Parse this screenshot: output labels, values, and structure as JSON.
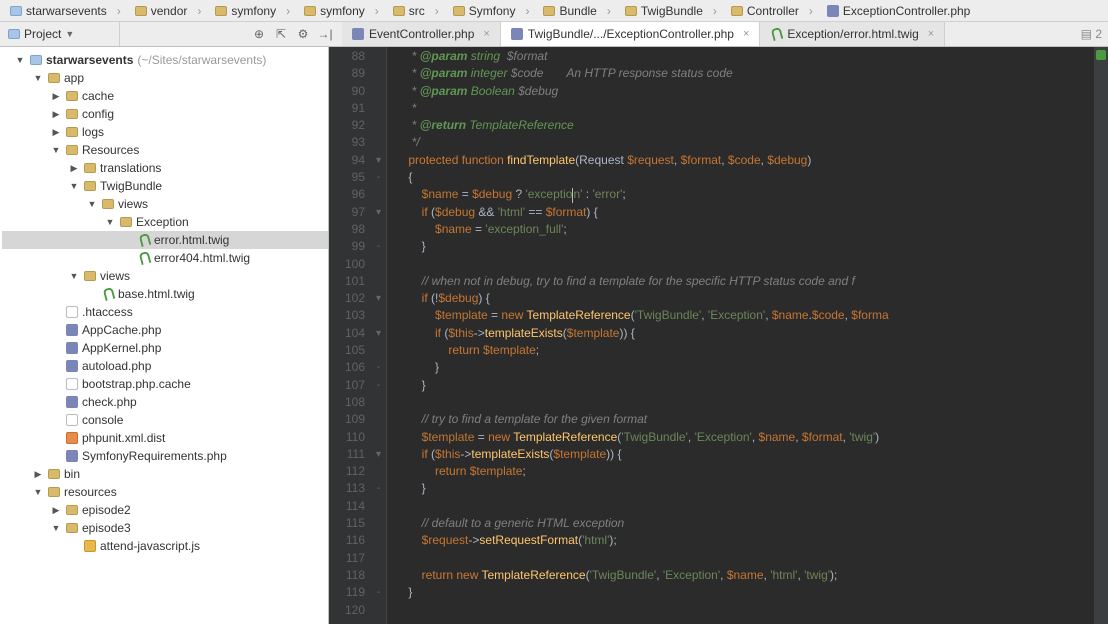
{
  "breadcrumbs": [
    {
      "label": "starwarsevents",
      "icon": "folder-blue"
    },
    {
      "label": "vendor",
      "icon": "folder"
    },
    {
      "label": "symfony",
      "icon": "folder"
    },
    {
      "label": "symfony",
      "icon": "folder"
    },
    {
      "label": "src",
      "icon": "folder"
    },
    {
      "label": "Symfony",
      "icon": "folder"
    },
    {
      "label": "Bundle",
      "icon": "folder"
    },
    {
      "label": "TwigBundle",
      "icon": "folder"
    },
    {
      "label": "Controller",
      "icon": "folder"
    },
    {
      "label": "ExceptionController.php",
      "icon": "php"
    }
  ],
  "project_selector": "Project",
  "tabs": [
    {
      "label": "EventController.php",
      "icon": "php",
      "active": false
    },
    {
      "label": "TwigBundle/.../ExceptionController.php",
      "icon": "php",
      "active": true
    },
    {
      "label": "Exception/error.html.twig",
      "icon": "twig",
      "active": false
    }
  ],
  "tabs_extra": "▤ 2",
  "tree": [
    {
      "indent": 0,
      "arrow": "down",
      "icon": "folder-blue",
      "label": "starwarsevents",
      "path": " (~/Sites/starwarsevents)",
      "bold": true
    },
    {
      "indent": 1,
      "arrow": "down",
      "icon": "folder",
      "label": "app"
    },
    {
      "indent": 2,
      "arrow": "right",
      "icon": "folder",
      "label": "cache"
    },
    {
      "indent": 2,
      "arrow": "right",
      "icon": "folder",
      "label": "config"
    },
    {
      "indent": 2,
      "arrow": "right",
      "icon": "folder",
      "label": "logs"
    },
    {
      "indent": 2,
      "arrow": "down",
      "icon": "folder",
      "label": "Resources"
    },
    {
      "indent": 3,
      "arrow": "right",
      "icon": "folder",
      "label": "translations"
    },
    {
      "indent": 3,
      "arrow": "down",
      "icon": "folder",
      "label": "TwigBundle"
    },
    {
      "indent": 4,
      "arrow": "down",
      "icon": "folder",
      "label": "views"
    },
    {
      "indent": 5,
      "arrow": "down",
      "icon": "folder",
      "label": "Exception"
    },
    {
      "indent": 6,
      "arrow": "",
      "icon": "twig",
      "label": "error.html.twig",
      "selected": true
    },
    {
      "indent": 6,
      "arrow": "",
      "icon": "twig",
      "label": "error404.html.twig"
    },
    {
      "indent": 3,
      "arrow": "down",
      "icon": "folder",
      "label": "views"
    },
    {
      "indent": 4,
      "arrow": "",
      "icon": "twig",
      "label": "base.html.twig"
    },
    {
      "indent": 2,
      "arrow": "",
      "icon": "file",
      "label": ".htaccess"
    },
    {
      "indent": 2,
      "arrow": "",
      "icon": "php",
      "label": "AppCache.php"
    },
    {
      "indent": 2,
      "arrow": "",
      "icon": "php",
      "label": "AppKernel.php"
    },
    {
      "indent": 2,
      "arrow": "",
      "icon": "php",
      "label": "autoload.php"
    },
    {
      "indent": 2,
      "arrow": "",
      "icon": "file",
      "label": "bootstrap.php.cache"
    },
    {
      "indent": 2,
      "arrow": "",
      "icon": "php",
      "label": "check.php"
    },
    {
      "indent": 2,
      "arrow": "",
      "icon": "file",
      "label": "console"
    },
    {
      "indent": 2,
      "arrow": "",
      "icon": "xml",
      "label": "phpunit.xml.dist"
    },
    {
      "indent": 2,
      "arrow": "",
      "icon": "php",
      "label": "SymfonyRequirements.php"
    },
    {
      "indent": 1,
      "arrow": "right",
      "icon": "folder",
      "label": "bin"
    },
    {
      "indent": 1,
      "arrow": "down",
      "icon": "folder",
      "label": "resources"
    },
    {
      "indent": 2,
      "arrow": "right",
      "icon": "folder",
      "label": "episode2"
    },
    {
      "indent": 2,
      "arrow": "down",
      "icon": "folder",
      "label": "episode3"
    },
    {
      "indent": 3,
      "arrow": "",
      "icon": "js",
      "label": "attend-javascript.js"
    }
  ],
  "line_start": 88,
  "line_end": 120
}
